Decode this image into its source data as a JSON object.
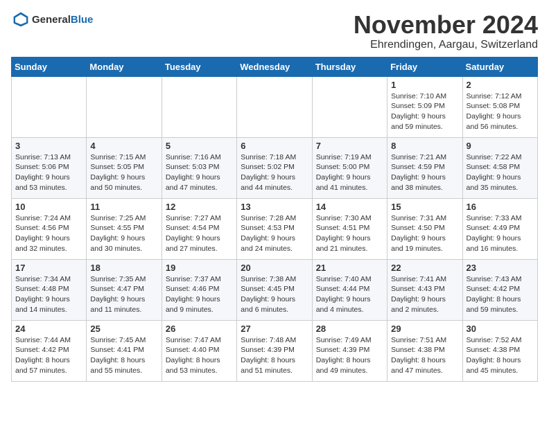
{
  "logo": {
    "general": "General",
    "blue": "Blue"
  },
  "header": {
    "month": "November 2024",
    "location": "Ehrendingen, Aargau, Switzerland"
  },
  "weekdays": [
    "Sunday",
    "Monday",
    "Tuesday",
    "Wednesday",
    "Thursday",
    "Friday",
    "Saturday"
  ],
  "weeks": [
    [
      {
        "day": "",
        "info": ""
      },
      {
        "day": "",
        "info": ""
      },
      {
        "day": "",
        "info": ""
      },
      {
        "day": "",
        "info": ""
      },
      {
        "day": "",
        "info": ""
      },
      {
        "day": "1",
        "info": "Sunrise: 7:10 AM\nSunset: 5:09 PM\nDaylight: 9 hours and 59 minutes."
      },
      {
        "day": "2",
        "info": "Sunrise: 7:12 AM\nSunset: 5:08 PM\nDaylight: 9 hours and 56 minutes."
      }
    ],
    [
      {
        "day": "3",
        "info": "Sunrise: 7:13 AM\nSunset: 5:06 PM\nDaylight: 9 hours and 53 minutes."
      },
      {
        "day": "4",
        "info": "Sunrise: 7:15 AM\nSunset: 5:05 PM\nDaylight: 9 hours and 50 minutes."
      },
      {
        "day": "5",
        "info": "Sunrise: 7:16 AM\nSunset: 5:03 PM\nDaylight: 9 hours and 47 minutes."
      },
      {
        "day": "6",
        "info": "Sunrise: 7:18 AM\nSunset: 5:02 PM\nDaylight: 9 hours and 44 minutes."
      },
      {
        "day": "7",
        "info": "Sunrise: 7:19 AM\nSunset: 5:00 PM\nDaylight: 9 hours and 41 minutes."
      },
      {
        "day": "8",
        "info": "Sunrise: 7:21 AM\nSunset: 4:59 PM\nDaylight: 9 hours and 38 minutes."
      },
      {
        "day": "9",
        "info": "Sunrise: 7:22 AM\nSunset: 4:58 PM\nDaylight: 9 hours and 35 minutes."
      }
    ],
    [
      {
        "day": "10",
        "info": "Sunrise: 7:24 AM\nSunset: 4:56 PM\nDaylight: 9 hours and 32 minutes."
      },
      {
        "day": "11",
        "info": "Sunrise: 7:25 AM\nSunset: 4:55 PM\nDaylight: 9 hours and 30 minutes."
      },
      {
        "day": "12",
        "info": "Sunrise: 7:27 AM\nSunset: 4:54 PM\nDaylight: 9 hours and 27 minutes."
      },
      {
        "day": "13",
        "info": "Sunrise: 7:28 AM\nSunset: 4:53 PM\nDaylight: 9 hours and 24 minutes."
      },
      {
        "day": "14",
        "info": "Sunrise: 7:30 AM\nSunset: 4:51 PM\nDaylight: 9 hours and 21 minutes."
      },
      {
        "day": "15",
        "info": "Sunrise: 7:31 AM\nSunset: 4:50 PM\nDaylight: 9 hours and 19 minutes."
      },
      {
        "day": "16",
        "info": "Sunrise: 7:33 AM\nSunset: 4:49 PM\nDaylight: 9 hours and 16 minutes."
      }
    ],
    [
      {
        "day": "17",
        "info": "Sunrise: 7:34 AM\nSunset: 4:48 PM\nDaylight: 9 hours and 14 minutes."
      },
      {
        "day": "18",
        "info": "Sunrise: 7:35 AM\nSunset: 4:47 PM\nDaylight: 9 hours and 11 minutes."
      },
      {
        "day": "19",
        "info": "Sunrise: 7:37 AM\nSunset: 4:46 PM\nDaylight: 9 hours and 9 minutes."
      },
      {
        "day": "20",
        "info": "Sunrise: 7:38 AM\nSunset: 4:45 PM\nDaylight: 9 hours and 6 minutes."
      },
      {
        "day": "21",
        "info": "Sunrise: 7:40 AM\nSunset: 4:44 PM\nDaylight: 9 hours and 4 minutes."
      },
      {
        "day": "22",
        "info": "Sunrise: 7:41 AM\nSunset: 4:43 PM\nDaylight: 9 hours and 2 minutes."
      },
      {
        "day": "23",
        "info": "Sunrise: 7:43 AM\nSunset: 4:42 PM\nDaylight: 8 hours and 59 minutes."
      }
    ],
    [
      {
        "day": "24",
        "info": "Sunrise: 7:44 AM\nSunset: 4:42 PM\nDaylight: 8 hours and 57 minutes."
      },
      {
        "day": "25",
        "info": "Sunrise: 7:45 AM\nSunset: 4:41 PM\nDaylight: 8 hours and 55 minutes."
      },
      {
        "day": "26",
        "info": "Sunrise: 7:47 AM\nSunset: 4:40 PM\nDaylight: 8 hours and 53 minutes."
      },
      {
        "day": "27",
        "info": "Sunrise: 7:48 AM\nSunset: 4:39 PM\nDaylight: 8 hours and 51 minutes."
      },
      {
        "day": "28",
        "info": "Sunrise: 7:49 AM\nSunset: 4:39 PM\nDaylight: 8 hours and 49 minutes."
      },
      {
        "day": "29",
        "info": "Sunrise: 7:51 AM\nSunset: 4:38 PM\nDaylight: 8 hours and 47 minutes."
      },
      {
        "day": "30",
        "info": "Sunrise: 7:52 AM\nSunset: 4:38 PM\nDaylight: 8 hours and 45 minutes."
      }
    ]
  ]
}
